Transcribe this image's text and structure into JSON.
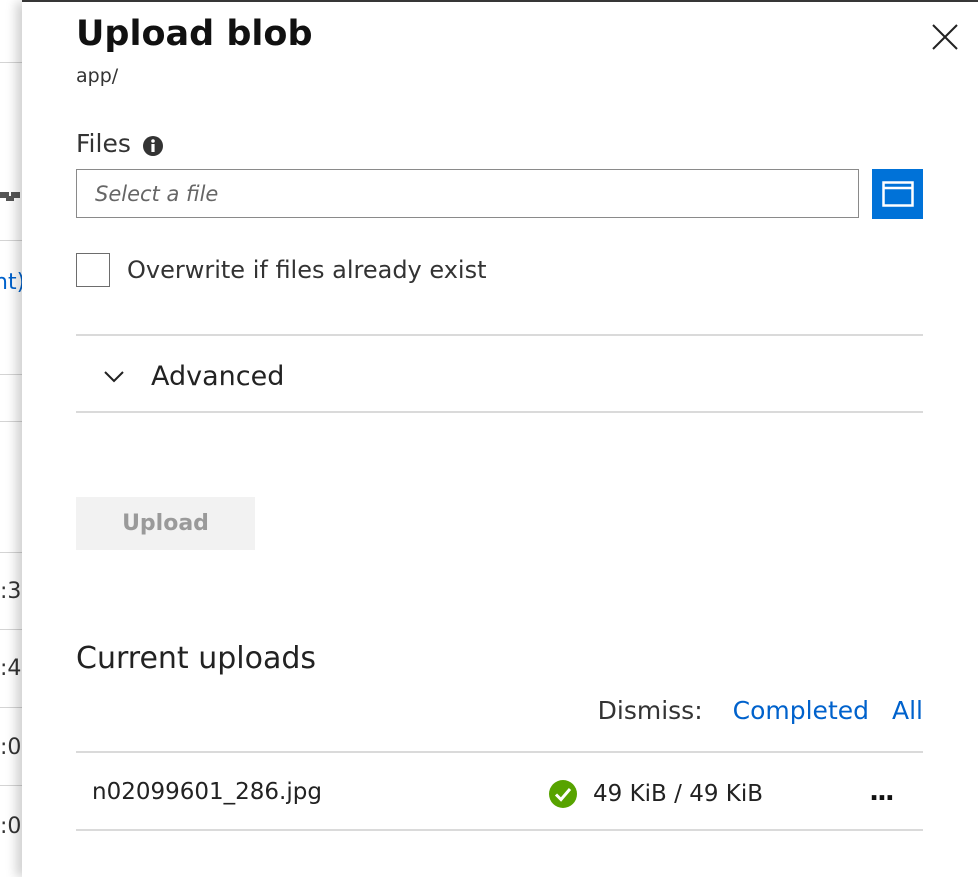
{
  "panel": {
    "title": "Upload blob",
    "subtitle": "app/"
  },
  "files": {
    "label": "Files",
    "placeholder": "Select a file"
  },
  "overwrite": {
    "label": "Overwrite if files already exist",
    "checked": false
  },
  "advanced": {
    "label": "Advanced"
  },
  "actions": {
    "upload_label": "Upload"
  },
  "current_uploads": {
    "title": "Current uploads",
    "dismiss_label": "Dismiss:",
    "dismiss_completed": "Completed",
    "dismiss_all": "All",
    "items": [
      {
        "file_name": "n02099601_286.jpg",
        "status": "completed",
        "progress": "49 KiB / 49 KiB",
        "more": "..."
      }
    ]
  },
  "background": {
    "link_fragment": "nt)",
    "time_fragments": [
      ":3",
      ":4",
      ":0",
      ":0"
    ]
  },
  "colors": {
    "accent": "#0072d8",
    "link": "#0062cc",
    "success": "#57a300",
    "divider": "#dadada"
  }
}
